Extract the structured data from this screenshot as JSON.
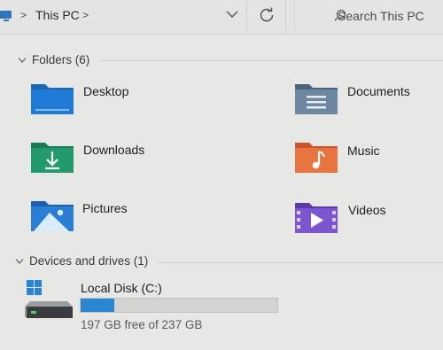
{
  "address": {
    "breadcrumb": "This PC",
    "separator": ">",
    "trailing_separator": ">",
    "search_placeholder": "Search This PC"
  },
  "folders_section": {
    "title": "Folders (6)",
    "items": [
      {
        "label": "Desktop",
        "icon": "desktop-folder-icon"
      },
      {
        "label": "Documents",
        "icon": "documents-folder-icon"
      },
      {
        "label": "Downloads",
        "icon": "downloads-folder-icon"
      },
      {
        "label": "Music",
        "icon": "music-folder-icon"
      },
      {
        "label": "Pictures",
        "icon": "pictures-folder-icon"
      },
      {
        "label": "Videos",
        "icon": "videos-folder-icon"
      }
    ]
  },
  "drives_section": {
    "title": "Devices and drives (1)",
    "drives": [
      {
        "name": "Local Disk (C:)",
        "free_text": "197 GB free of 237 GB",
        "used_fraction": 0.17,
        "icon": "windows-drive-icon"
      }
    ]
  },
  "colors": {
    "accent": "#2a86d0",
    "background": "#e7e8e6"
  }
}
